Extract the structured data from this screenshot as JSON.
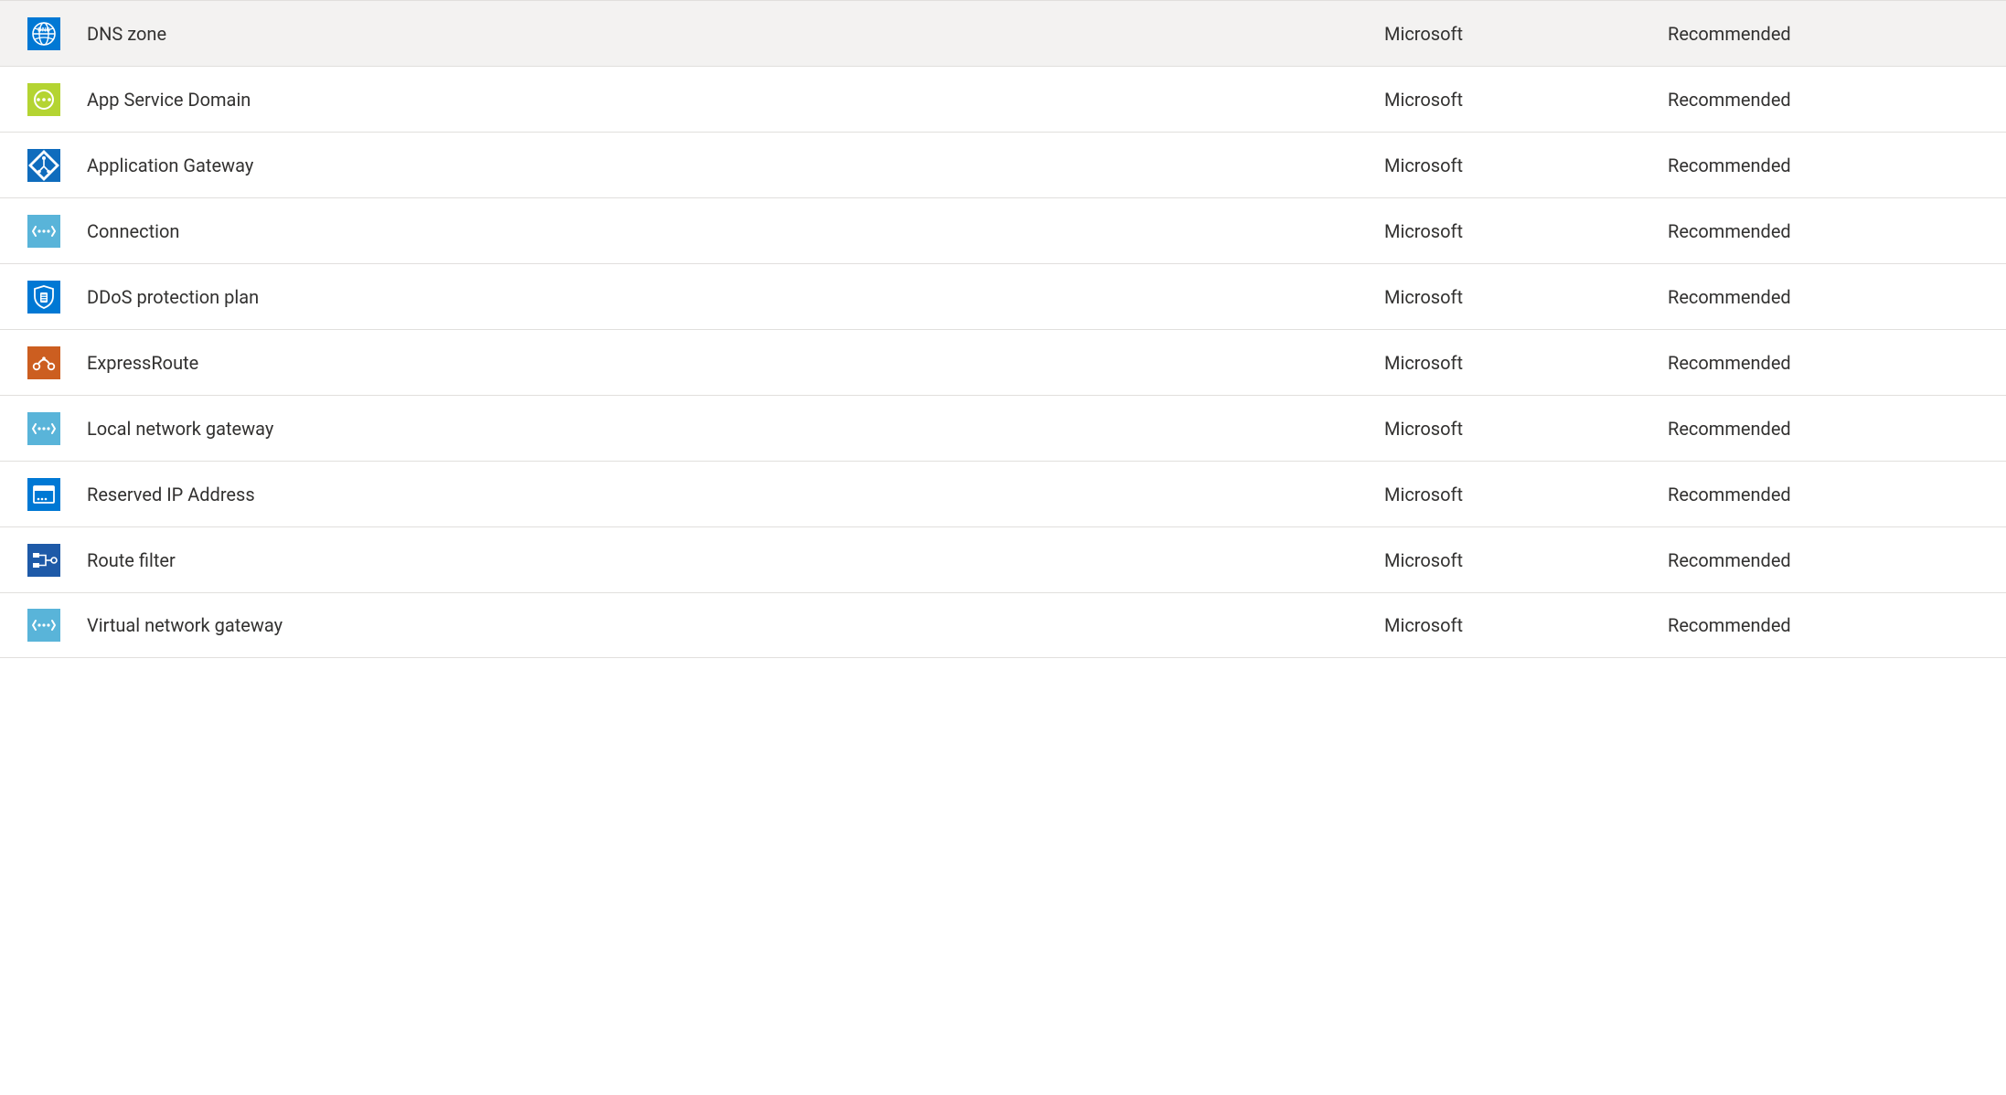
{
  "colors": {
    "azure_blue": "#0078d4",
    "azure_blue_dark": "#005a9e",
    "lime_green": "#b4d432",
    "light_blue": "#59b4d9",
    "orange": "#d35400",
    "route_blue": "#1e5aa8"
  },
  "table": {
    "rows": [
      {
        "icon": "dns-zone-icon",
        "name": "DNS zone",
        "publisher": "Microsoft",
        "useful": "Recommended"
      },
      {
        "icon": "app-service-domain-icon",
        "name": "App Service Domain",
        "publisher": "Microsoft",
        "useful": "Recommended"
      },
      {
        "icon": "application-gateway-icon",
        "name": "Application Gateway",
        "publisher": "Microsoft",
        "useful": "Recommended"
      },
      {
        "icon": "connection-icon",
        "name": "Connection",
        "publisher": "Microsoft",
        "useful": "Recommended"
      },
      {
        "icon": "ddos-protection-icon",
        "name": "DDoS protection plan",
        "publisher": "Microsoft",
        "useful": "Recommended"
      },
      {
        "icon": "expressroute-icon",
        "name": "ExpressRoute",
        "publisher": "Microsoft",
        "useful": "Recommended"
      },
      {
        "icon": "local-network-gateway-icon",
        "name": "Local network gateway",
        "publisher": "Microsoft",
        "useful": "Recommended"
      },
      {
        "icon": "reserved-ip-icon",
        "name": "Reserved IP Address",
        "publisher": "Microsoft",
        "useful": "Recommended"
      },
      {
        "icon": "route-filter-icon",
        "name": "Route filter",
        "publisher": "Microsoft",
        "useful": "Recommended"
      },
      {
        "icon": "virtual-network-gateway-icon",
        "name": "Virtual network gateway",
        "publisher": "Microsoft",
        "useful": "Recommended"
      }
    ]
  }
}
